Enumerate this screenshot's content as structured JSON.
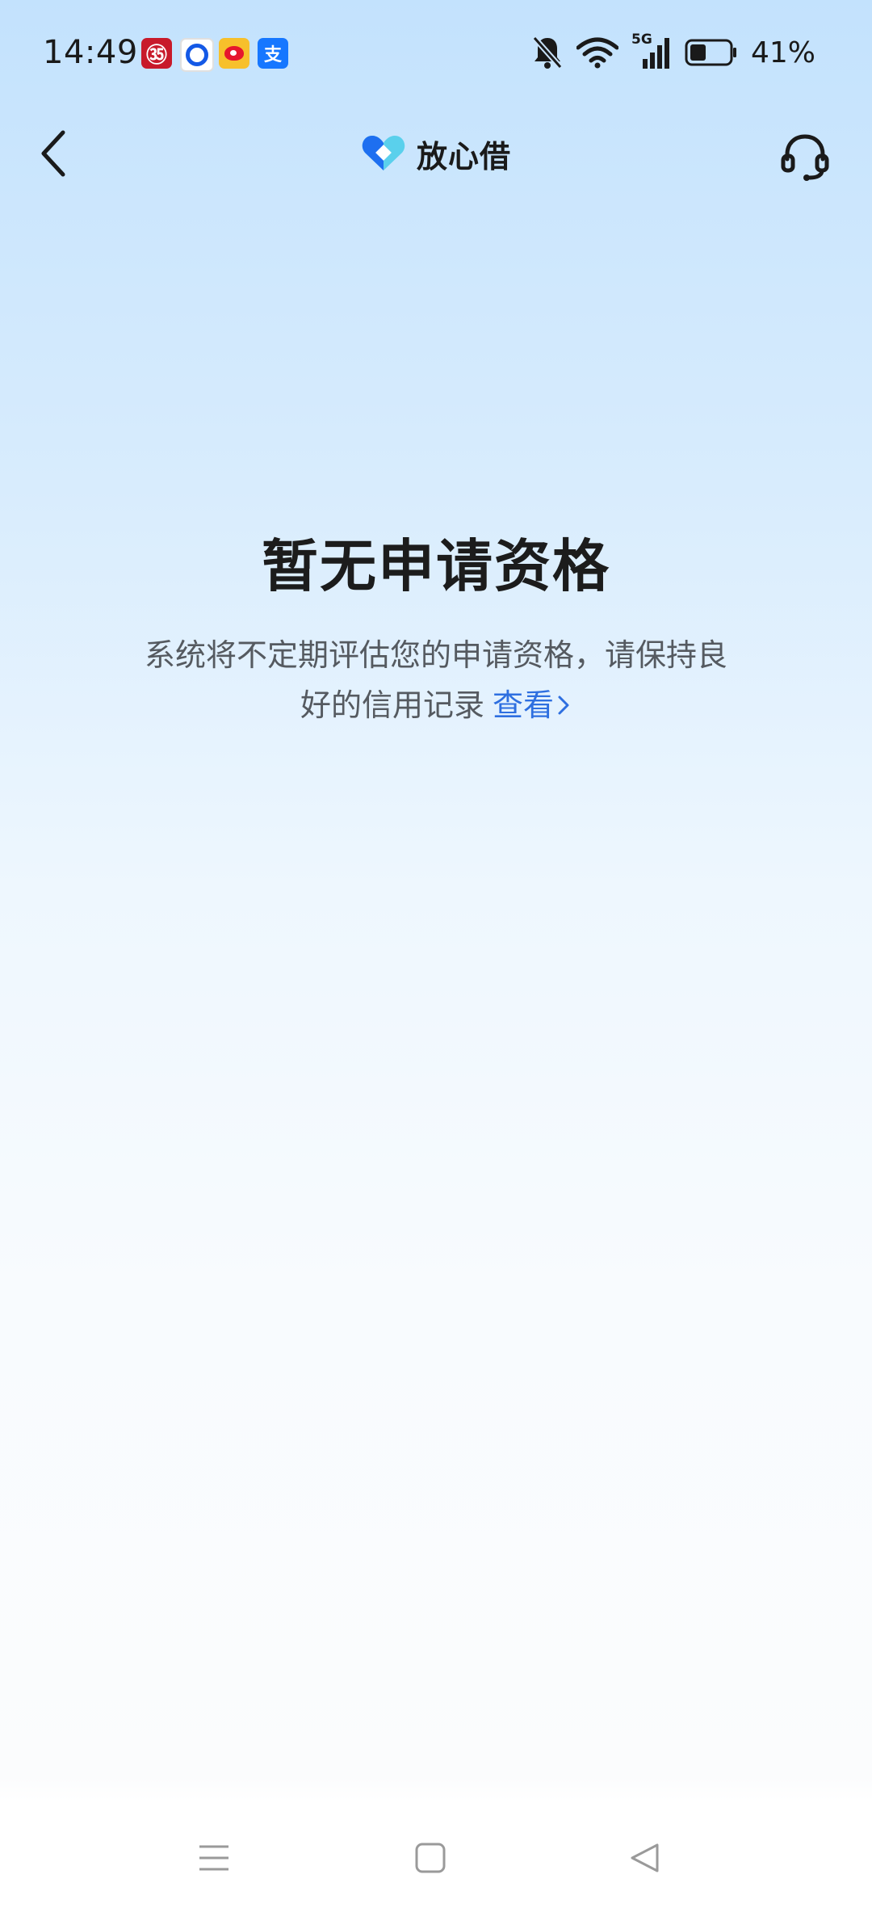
{
  "status_bar": {
    "time": "14:49",
    "notification_icons": [
      "bank-app-icon",
      "messaging-app-icon",
      "weibo-app-icon",
      "alipay-app-icon"
    ],
    "alipay_glyph": "支",
    "bank_glyph": "㉟",
    "network_label": "5G",
    "battery_percent": "41%",
    "battery_level": 0.41
  },
  "header": {
    "brand_name": "放心借",
    "brand_colors": [
      "#1e6ff0",
      "#36c2e8"
    ]
  },
  "main": {
    "title": "暂无申请资格",
    "description_line1": "系统将不定期评估您的申请资格，请保持良",
    "description_line2": "好的信用记录",
    "view_link_label": "查看",
    "link_color": "#2e6fe0"
  }
}
